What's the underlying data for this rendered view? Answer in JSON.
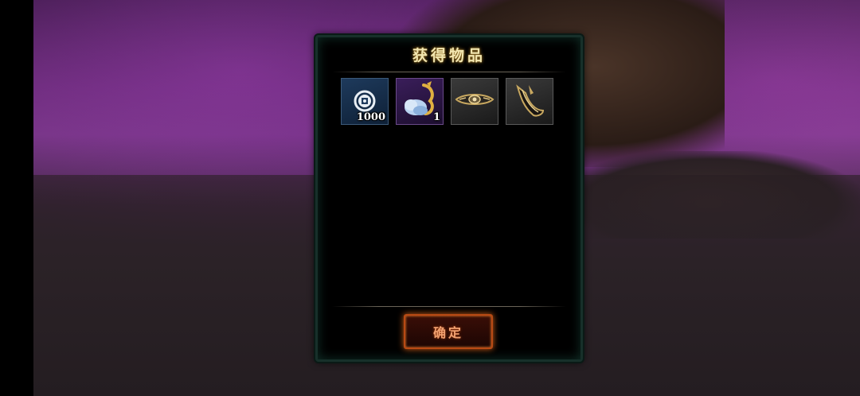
{
  "dialog": {
    "title": "获得物品",
    "confirm_label": "确定"
  },
  "items": [
    {
      "icon": "coin-icon",
      "count": "1000",
      "rarity_color": "#1e3a5c"
    },
    {
      "icon": "cloud-dragon-icon",
      "count": "1",
      "rarity_color": "#3a1e5a"
    },
    {
      "icon": "ornate-headband-icon",
      "count": "",
      "rarity_color": "#3a3a3a"
    },
    {
      "icon": "horn-ornament-icon",
      "count": "",
      "rarity_color": "#3a3a3a"
    }
  ],
  "colors": {
    "title": "#f2e6b0",
    "button_border": "#b84a14",
    "button_text": "#f0a070",
    "dialog_border": "#17302a"
  }
}
